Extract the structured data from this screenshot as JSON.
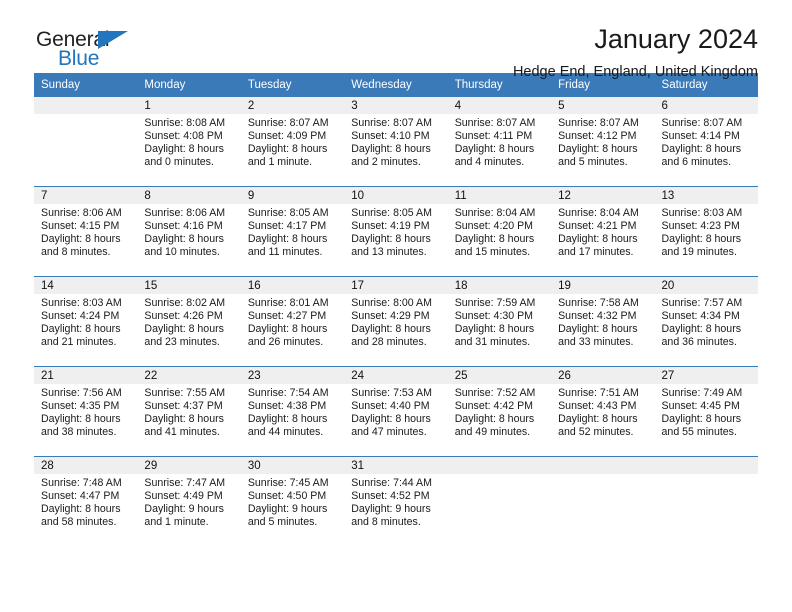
{
  "brand": {
    "name_part1": "General",
    "name_part2": "Blue",
    "accent_color": "#2176bd",
    "triangle_icon": "brand-triangle-icon"
  },
  "header": {
    "title": "January 2024",
    "subtitle": "Hedge End, England, United Kingdom",
    "header_bg_color": "#3a7ab8",
    "daynum_band_color": "#efefef"
  },
  "weekdays": [
    "Sunday",
    "Monday",
    "Tuesday",
    "Wednesday",
    "Thursday",
    "Friday",
    "Saturday"
  ],
  "labels": {
    "sunrise_prefix": "Sunrise:",
    "sunset_prefix": "Sunset:",
    "daylight_prefix": "Daylight:"
  },
  "weeks": [
    [
      {
        "day": "",
        "line1": "",
        "line2": "",
        "line3": "",
        "line4": "",
        "empty": true
      },
      {
        "day": "1",
        "line1": "Sunrise: 8:08 AM",
        "line2": "Sunset: 4:08 PM",
        "line3": "Daylight: 8 hours",
        "line4": "and 0 minutes."
      },
      {
        "day": "2",
        "line1": "Sunrise: 8:07 AM",
        "line2": "Sunset: 4:09 PM",
        "line3": "Daylight: 8 hours",
        "line4": "and 1 minute."
      },
      {
        "day": "3",
        "line1": "Sunrise: 8:07 AM",
        "line2": "Sunset: 4:10 PM",
        "line3": "Daylight: 8 hours",
        "line4": "and 2 minutes."
      },
      {
        "day": "4",
        "line1": "Sunrise: 8:07 AM",
        "line2": "Sunset: 4:11 PM",
        "line3": "Daylight: 8 hours",
        "line4": "and 4 minutes."
      },
      {
        "day": "5",
        "line1": "Sunrise: 8:07 AM",
        "line2": "Sunset: 4:12 PM",
        "line3": "Daylight: 8 hours",
        "line4": "and 5 minutes."
      },
      {
        "day": "6",
        "line1": "Sunrise: 8:07 AM",
        "line2": "Sunset: 4:14 PM",
        "line3": "Daylight: 8 hours",
        "line4": "and 6 minutes."
      }
    ],
    [
      {
        "day": "7",
        "line1": "Sunrise: 8:06 AM",
        "line2": "Sunset: 4:15 PM",
        "line3": "Daylight: 8 hours",
        "line4": "and 8 minutes."
      },
      {
        "day": "8",
        "line1": "Sunrise: 8:06 AM",
        "line2": "Sunset: 4:16 PM",
        "line3": "Daylight: 8 hours",
        "line4": "and 10 minutes."
      },
      {
        "day": "9",
        "line1": "Sunrise: 8:05 AM",
        "line2": "Sunset: 4:17 PM",
        "line3": "Daylight: 8 hours",
        "line4": "and 11 minutes."
      },
      {
        "day": "10",
        "line1": "Sunrise: 8:05 AM",
        "line2": "Sunset: 4:19 PM",
        "line3": "Daylight: 8 hours",
        "line4": "and 13 minutes."
      },
      {
        "day": "11",
        "line1": "Sunrise: 8:04 AM",
        "line2": "Sunset: 4:20 PM",
        "line3": "Daylight: 8 hours",
        "line4": "and 15 minutes."
      },
      {
        "day": "12",
        "line1": "Sunrise: 8:04 AM",
        "line2": "Sunset: 4:21 PM",
        "line3": "Daylight: 8 hours",
        "line4": "and 17 minutes."
      },
      {
        "day": "13",
        "line1": "Sunrise: 8:03 AM",
        "line2": "Sunset: 4:23 PM",
        "line3": "Daylight: 8 hours",
        "line4": "and 19 minutes."
      }
    ],
    [
      {
        "day": "14",
        "line1": "Sunrise: 8:03 AM",
        "line2": "Sunset: 4:24 PM",
        "line3": "Daylight: 8 hours",
        "line4": "and 21 minutes."
      },
      {
        "day": "15",
        "line1": "Sunrise: 8:02 AM",
        "line2": "Sunset: 4:26 PM",
        "line3": "Daylight: 8 hours",
        "line4": "and 23 minutes."
      },
      {
        "day": "16",
        "line1": "Sunrise: 8:01 AM",
        "line2": "Sunset: 4:27 PM",
        "line3": "Daylight: 8 hours",
        "line4": "and 26 minutes."
      },
      {
        "day": "17",
        "line1": "Sunrise: 8:00 AM",
        "line2": "Sunset: 4:29 PM",
        "line3": "Daylight: 8 hours",
        "line4": "and 28 minutes."
      },
      {
        "day": "18",
        "line1": "Sunrise: 7:59 AM",
        "line2": "Sunset: 4:30 PM",
        "line3": "Daylight: 8 hours",
        "line4": "and 31 minutes."
      },
      {
        "day": "19",
        "line1": "Sunrise: 7:58 AM",
        "line2": "Sunset: 4:32 PM",
        "line3": "Daylight: 8 hours",
        "line4": "and 33 minutes."
      },
      {
        "day": "20",
        "line1": "Sunrise: 7:57 AM",
        "line2": "Sunset: 4:34 PM",
        "line3": "Daylight: 8 hours",
        "line4": "and 36 minutes."
      }
    ],
    [
      {
        "day": "21",
        "line1": "Sunrise: 7:56 AM",
        "line2": "Sunset: 4:35 PM",
        "line3": "Daylight: 8 hours",
        "line4": "and 38 minutes."
      },
      {
        "day": "22",
        "line1": "Sunrise: 7:55 AM",
        "line2": "Sunset: 4:37 PM",
        "line3": "Daylight: 8 hours",
        "line4": "and 41 minutes."
      },
      {
        "day": "23",
        "line1": "Sunrise: 7:54 AM",
        "line2": "Sunset: 4:38 PM",
        "line3": "Daylight: 8 hours",
        "line4": "and 44 minutes."
      },
      {
        "day": "24",
        "line1": "Sunrise: 7:53 AM",
        "line2": "Sunset: 4:40 PM",
        "line3": "Daylight: 8 hours",
        "line4": "and 47 minutes."
      },
      {
        "day": "25",
        "line1": "Sunrise: 7:52 AM",
        "line2": "Sunset: 4:42 PM",
        "line3": "Daylight: 8 hours",
        "line4": "and 49 minutes."
      },
      {
        "day": "26",
        "line1": "Sunrise: 7:51 AM",
        "line2": "Sunset: 4:43 PM",
        "line3": "Daylight: 8 hours",
        "line4": "and 52 minutes."
      },
      {
        "day": "27",
        "line1": "Sunrise: 7:49 AM",
        "line2": "Sunset: 4:45 PM",
        "line3": "Daylight: 8 hours",
        "line4": "and 55 minutes."
      }
    ],
    [
      {
        "day": "28",
        "line1": "Sunrise: 7:48 AM",
        "line2": "Sunset: 4:47 PM",
        "line3": "Daylight: 8 hours",
        "line4": "and 58 minutes."
      },
      {
        "day": "29",
        "line1": "Sunrise: 7:47 AM",
        "line2": "Sunset: 4:49 PM",
        "line3": "Daylight: 9 hours",
        "line4": "and 1 minute."
      },
      {
        "day": "30",
        "line1": "Sunrise: 7:45 AM",
        "line2": "Sunset: 4:50 PM",
        "line3": "Daylight: 9 hours",
        "line4": "and 5 minutes."
      },
      {
        "day": "31",
        "line1": "Sunrise: 7:44 AM",
        "line2": "Sunset: 4:52 PM",
        "line3": "Daylight: 9 hours",
        "line4": "and 8 minutes."
      },
      {
        "day": "",
        "line1": "",
        "line2": "",
        "line3": "",
        "line4": "",
        "empty": true
      },
      {
        "day": "",
        "line1": "",
        "line2": "",
        "line3": "",
        "line4": "",
        "empty": true
      },
      {
        "day": "",
        "line1": "",
        "line2": "",
        "line3": "",
        "line4": "",
        "empty": true
      }
    ]
  ]
}
